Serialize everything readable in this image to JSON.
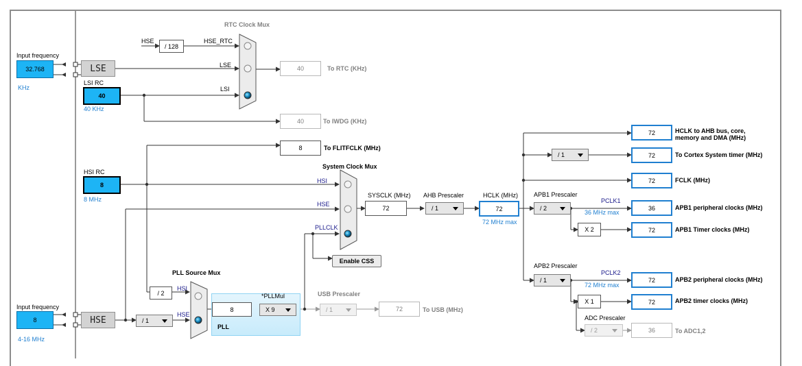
{
  "rtc": {
    "mux_title": "RTC Clock Mux",
    "hse_label": "HSE",
    "div_label": "/ 128",
    "hse_rtc_label": "HSE_RTC",
    "lse_label": "LSE",
    "lsi_label": "LSI",
    "value": "40",
    "output_label": "To RTC (KHz)"
  },
  "lse_input": {
    "title": "Input frequency",
    "value": "32.768",
    "unit": "KHz",
    "osc_label": "LSE"
  },
  "lsi": {
    "title": "LSI RC",
    "value": "40",
    "sub": "40 KHz"
  },
  "iwdg": {
    "value": "40",
    "label": "To IWDG (KHz)"
  },
  "flitf": {
    "value": "8",
    "label": "To FLITFCLK (MHz)"
  },
  "hsi": {
    "title": "HSI RC",
    "value": "8",
    "sub": "8 MHz"
  },
  "sysmux": {
    "title": "System Clock Mux",
    "hsi": "HSI",
    "hse": "HSE",
    "pllclk": "PLLCLK"
  },
  "sysclk": {
    "label": "SYSCLK (MHz)",
    "value": "72"
  },
  "ahb": {
    "label": "AHB Prescaler",
    "value": "/ 1"
  },
  "hclk": {
    "label": "HCLK (MHz)",
    "value": "72",
    "max": "72 MHz max"
  },
  "css": {
    "label": "Enable CSS"
  },
  "outputs": {
    "hclk_ahb": {
      "value": "72",
      "label": "HCLK to AHB bus, core,\nmemory and DMA (MHz)"
    },
    "cortex": {
      "div": "/ 1",
      "value": "72",
      "label": "To Cortex System timer (MHz)"
    },
    "fclk": {
      "value": "72",
      "label": "FCLK (MHz)"
    }
  },
  "apb1": {
    "title": "APB1 Prescaler",
    "value": "/ 2",
    "pclk": "PCLK1",
    "max": "36 MHz max",
    "periph_value": "36",
    "periph_label": "APB1 peripheral clocks (MHz)",
    "mult": "X 2",
    "timer_value": "72",
    "timer_label": "APB1 Timer clocks (MHz)"
  },
  "apb2": {
    "title": "APB2 Prescaler",
    "value": "/ 1",
    "pclk": "PCLK2",
    "max": "72 MHz max",
    "periph_value": "72",
    "periph_label": "APB2 peripheral clocks (MHz)",
    "mult": "X 1",
    "timer_value": "72",
    "timer_label": "APB2 timer clocks (MHz)"
  },
  "adc": {
    "title": "ADC Prescaler",
    "value": "/ 2",
    "out": "36",
    "label": "To ADC1,2"
  },
  "hse_input": {
    "title": "Input frequency",
    "value": "8",
    "range": "4-16 MHz",
    "osc_label": "HSE"
  },
  "pllsrc": {
    "title": "PLL Source Mux",
    "div2": "/ 2",
    "hsi": "HSI",
    "hse": "HSE",
    "prediv": "/ 1"
  },
  "pll": {
    "value": "8",
    "mul_title": "*PLLMul",
    "mul": "X 9",
    "label": "PLL"
  },
  "usb": {
    "title": "USB Prescaler",
    "value": "/ 1",
    "out": "72",
    "label": "To USB (MHz)"
  },
  "colors": {
    "input_blue": "#1db4f5",
    "output_blue": "#1f7fd0",
    "pll_bg": "#d6f0fc"
  }
}
